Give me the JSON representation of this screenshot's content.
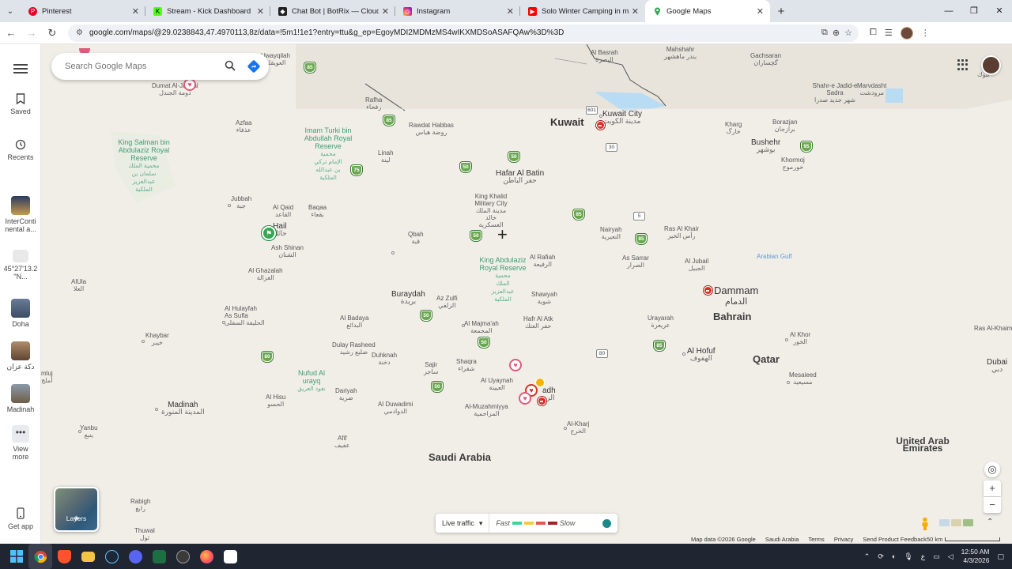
{
  "tabs": [
    {
      "title": "Pinterest",
      "icon": "pinterest-icon",
      "color": "#e60023"
    },
    {
      "title": "Stream - Kick Dashboard",
      "icon": "kick-icon",
      "color": "#53fc18"
    },
    {
      "title": "Chat Bot | BotRix — Cloud Stre",
      "icon": "botrix-icon",
      "color": "#222222"
    },
    {
      "title": "Instagram",
      "icon": "instagram-icon",
      "color": "#d62976"
    },
    {
      "title": "Solo Winter Camping in my Sup",
      "icon": "youtube-icon",
      "color": "#ff0000"
    },
    {
      "title": "Google Maps",
      "icon": "google-maps-icon",
      "color": "#34a853"
    }
  ],
  "url": "google.com/maps/@29.0238843,47.4970113,8z/data=!5m1!1e1?entry=ttu&g_ep=EgoyMDI2MDMzMS4wIKXMDSoASAFQAw%3D%3D",
  "search": {
    "placeholder": "Search Google Maps"
  },
  "sidebar": {
    "saved": "Saved",
    "recents": "Recents",
    "items": [
      {
        "label": "InterConti nental a..."
      },
      {
        "label": "45°27'13.2 \"N..."
      },
      {
        "label": "Doha"
      },
      {
        "label": "دكة عزان"
      },
      {
        "label": "Madinah"
      }
    ],
    "view_more": "View more",
    "get_app": "Get app"
  },
  "map_labels": {
    "kuwait": "Kuwait",
    "kuwait_city": "Kuwait City",
    "kuwait_city_ar": "مدينة الكويت",
    "hafar": "Hafar Al Batin",
    "hafar_ar": "حفر الباطن",
    "hail": "Hail",
    "hail_ar": "حائل",
    "buraydah": "Buraydah",
    "buraydah_ar": "بريدة",
    "dammam": "Dammam",
    "dammam_ar": "الدمام",
    "bahrain": "Bahrain",
    "qatar": "Qatar",
    "al_hofuf": "Al Hofuf",
    "al_hofuf_ar": "الهفوف",
    "madinah": "Madinah",
    "madinah_ar": "المدينة المنورة",
    "riyadh": "adh",
    "riyadh_ar": "الرد",
    "saudi_arabia": "Saudi Arabia",
    "uae": "United Arab Emirates",
    "bushehr": "Bushehr",
    "bushehr_ar": "بوشهر",
    "dubai": "Dubai",
    "dubai_ar": "دبي",
    "arabian_gulf": "Arabian Gulf",
    "king_salman": "King Salman bin Abdulaziz Royal Reserve",
    "king_salman_ar": "محمية الملك سلمان بن عبدالعزيز الملكية",
    "imam_turki": "Imam Turki bin Abdullah Royal Reserve",
    "imam_turki_ar": "محمية الإمام تركي بن عبدالله الملكية",
    "king_abdulaziz": "King Abdulaziz Royal Reserve",
    "king_abdulaziz_ar": "محمية الملك عبدالعزيز الملكية",
    "nufud": "Nufud Al urayq",
    "nufud_ar": "نفود العريق",
    "small": [
      {
        "en": "Uwayqilah",
        "ar": "العويقلة"
      },
      {
        "en": "Dumat Al-Jandal",
        "ar": "دومة الجندل"
      },
      {
        "en": "Rafha",
        "ar": "رفحاء"
      },
      {
        "en": "Rawdat Habbas",
        "ar": "روضة هباس"
      },
      {
        "en": "Azfaa",
        "ar": "عذفاء"
      },
      {
        "en": "Linah",
        "ar": "لينة"
      },
      {
        "en": "Jubbah",
        "ar": "جبة"
      },
      {
        "en": "Al Qaid",
        "ar": "القاعد"
      },
      {
        "en": "Baqaa",
        "ar": "بقعاء"
      },
      {
        "en": "King Khalid Military City",
        "ar": "مدينة الملك خالد العسكرية"
      },
      {
        "en": "Qbah",
        "ar": "قبة"
      },
      {
        "en": "Ash Shinan",
        "ar": "الشنان"
      },
      {
        "en": "Al Ghazalah",
        "ar": "الغزالة"
      },
      {
        "en": "AlUla",
        "ar": "العلا"
      },
      {
        "en": "Al Rafiah",
        "ar": "الرفيعة"
      },
      {
        "en": "Nairyah",
        "ar": "النعيرية"
      },
      {
        "en": "Ras Al Khair",
        "ar": "رأس الخير"
      },
      {
        "en": "As Sarrar",
        "ar": "الصرار"
      },
      {
        "en": "Al Jubail",
        "ar": "الجبيل"
      },
      {
        "en": "Shawyah",
        "ar": "شوية"
      },
      {
        "en": "Az Zulfi",
        "ar": "الزلفي"
      },
      {
        "en": "Al Hulayfah As Sufla",
        "ar": "الحليفة السفلى"
      },
      {
        "en": "Al Badaya",
        "ar": "البدائع"
      },
      {
        "en": "Al Majma'ah",
        "ar": "المجمعة"
      },
      {
        "en": "Hafr Al Atk",
        "ar": "حفر العتك"
      },
      {
        "en": "Urayarah",
        "ar": "عريعرة"
      },
      {
        "en": "Khaybar",
        "ar": "خيبر"
      },
      {
        "en": "Dulay Rasheed",
        "ar": "ضليع رشيد"
      },
      {
        "en": "Duhknah",
        "ar": "دخنة"
      },
      {
        "en": "Sajir",
        "ar": "ساجر"
      },
      {
        "en": "Shaqra",
        "ar": "شقراء"
      },
      {
        "en": "Al Uyaynah",
        "ar": "العيينة"
      },
      {
        "en": "Al Hisu",
        "ar": "الحسو"
      },
      {
        "en": "Dariyah",
        "ar": "ضرية"
      },
      {
        "en": "Al Duwadimi",
        "ar": "الدوادمي"
      },
      {
        "en": "Al-Muzahmiyya",
        "ar": "المزاحمية"
      },
      {
        "en": "Al-Kharj",
        "ar": "الخرج"
      },
      {
        "en": "Yanbu",
        "ar": "ينبع"
      },
      {
        "en": "Afif",
        "ar": "عفيف"
      },
      {
        "en": "Rabigh",
        "ar": "رابغ"
      },
      {
        "en": "Thuwal",
        "ar": "ثول"
      },
      {
        "en": "Al Khor",
        "ar": "الخور"
      },
      {
        "en": "Mesaieed",
        "ar": "مسيعيد"
      },
      {
        "en": "Kharg",
        "ar": "خارگ"
      },
      {
        "en": "Borazjan",
        "ar": "برازجان"
      },
      {
        "en": "Khormoj",
        "ar": "خورموج"
      },
      {
        "en": "Gachsaran",
        "ar": "گچساران"
      },
      {
        "en": "Marvdasht",
        "ar": "مرودشت"
      },
      {
        "en": "Shahr-e Jadid-e Sadra",
        "ar": "شهر جدید صدرا"
      },
      {
        "en": "Mahshahr",
        "ar": "بندر ماهشهر"
      },
      {
        "en": "Al Basrah",
        "ar": "البصرة"
      },
      {
        "en": "Ras Al-Khaim",
        "ar": ""
      },
      {
        "en": "mluj",
        "ar": "أملج"
      }
    ],
    "tabuk": "تبوك"
  },
  "route_shields": [
    "85",
    "85",
    "75",
    "50",
    "50",
    "50",
    "85",
    "85",
    "85",
    "50",
    "50",
    "75",
    "85",
    "50",
    "95",
    "80",
    "85",
    "30",
    "5",
    "80",
    "601"
  ],
  "controls": {
    "layers": "Layers",
    "live_traffic": "Live traffic",
    "fast": "Fast",
    "slow": "Slow",
    "traffic_colors": [
      "#3fd39a",
      "#f2cb4c",
      "#e35a4f",
      "#a32127"
    ]
  },
  "attribution": {
    "map_data": "Map data ©2026 Google",
    "country": "Saudi Arabia",
    "terms": "Terms",
    "privacy": "Privacy",
    "feedback": "Send Product Feedback",
    "scale": "50 km"
  },
  "taskbar": {
    "time": "12:50 AM",
    "date": "4/3/2026",
    "lang": "ع"
  }
}
